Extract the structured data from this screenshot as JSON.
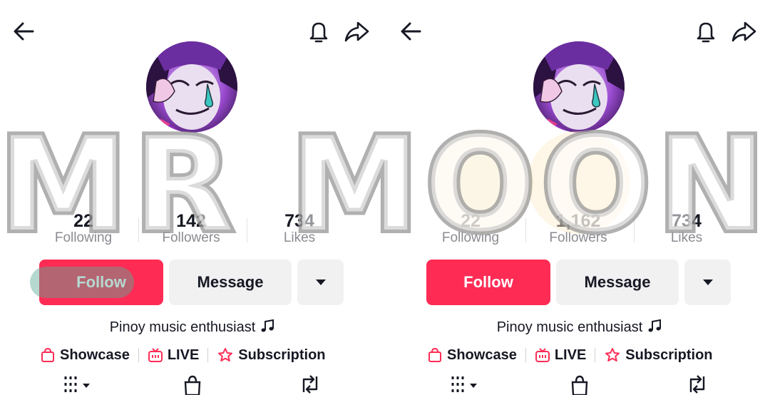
{
  "panels": [
    {
      "stats": [
        {
          "value": "22",
          "label": "Following"
        },
        {
          "value": "142",
          "label": "Followers"
        },
        {
          "value": "734",
          "label": "Likes"
        }
      ],
      "follow_label": "Follow",
      "message_label": "Message",
      "bio": "Pinoy music enthusiast",
      "links": [
        "Showcase",
        "LIVE",
        "Subscription"
      ]
    },
    {
      "stats": [
        {
          "value": "22",
          "label": "Following"
        },
        {
          "value": "1,162",
          "label": "Followers"
        },
        {
          "value": "734",
          "label": "Likes"
        }
      ],
      "follow_label": "Follow",
      "message_label": "Message",
      "bio": "Pinoy music enthusiast",
      "links": [
        "Showcase",
        "LIVE",
        "Subscription"
      ]
    }
  ],
  "icons": {
    "back": "arrow-left-icon",
    "bell": "bell-icon",
    "share": "share-icon",
    "more": "caret-down-icon",
    "bio": "music-note-icon",
    "showcase": "shopping-bag-icon",
    "live": "tv-icon",
    "subscription": "star-badge-icon",
    "tab_videos": "grid-icon",
    "tab_shop": "bag-icon",
    "tab_reposts": "repost-icon"
  },
  "colors": {
    "accent": "#fe2c55",
    "secondary_button": "#f1f1f2",
    "muted_text": "#8a8b91",
    "primary_text": "#161823"
  },
  "watermark": "MR MOON"
}
